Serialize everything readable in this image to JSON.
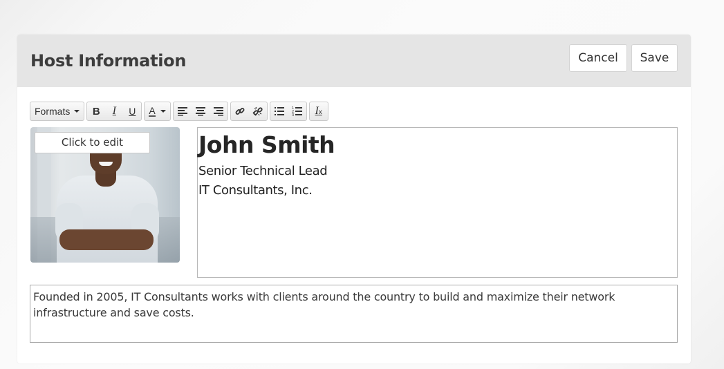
{
  "header": {
    "title": "Host Information",
    "cancel_label": "Cancel",
    "save_label": "Save"
  },
  "toolbar": {
    "formats_label": "Formats",
    "buttons": [
      {
        "name": "bold",
        "glyph": "B"
      },
      {
        "name": "italic",
        "glyph": "I"
      },
      {
        "name": "underline",
        "glyph": "U"
      },
      {
        "name": "text-color",
        "glyph": "A"
      },
      {
        "name": "align-left"
      },
      {
        "name": "align-center"
      },
      {
        "name": "align-right"
      },
      {
        "name": "insert-link"
      },
      {
        "name": "remove-link"
      },
      {
        "name": "bullet-list"
      },
      {
        "name": "numbered-list"
      },
      {
        "name": "clear-formatting",
        "glyph": "I",
        "subglyph": "x"
      }
    ]
  },
  "photo": {
    "overlay_label": "Click to edit",
    "alt": "Portrait of a smiling man with crossed arms"
  },
  "bio": {
    "name": "John Smith",
    "title": "Senior Technical Lead",
    "company": "IT Consultants, Inc."
  },
  "description": {
    "text": "Founded in 2005, IT Consultants works with clients around the country to build and maximize their network infrastructure and save costs."
  }
}
